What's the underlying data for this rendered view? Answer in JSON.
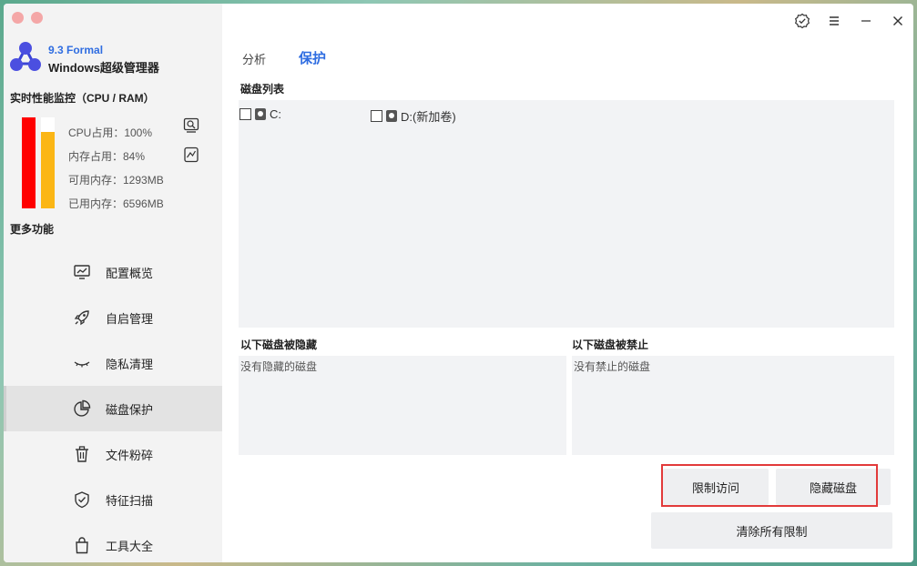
{
  "app": {
    "version": "9.3 Formal",
    "name": "Windows超级管理器"
  },
  "monitor": {
    "title": "实时性能监控（CPU / RAM）",
    "cpu_percent": 100,
    "ram_percent": 84,
    "cpu_label": "CPU占用：100%",
    "ram_label": "内存占用：84%",
    "avail_label": "可用内存：1293MB",
    "used_label": "已用内存：6596MB",
    "cpu_color": "#ff0000",
    "ram_color": "#fbb615"
  },
  "more_features": "更多功能",
  "nav": [
    {
      "label": "配置概览",
      "icon": "chart-monitor-icon",
      "active": false
    },
    {
      "label": "自启管理",
      "icon": "rocket-icon",
      "active": false
    },
    {
      "label": "隐私清理",
      "icon": "closed-eye-icon",
      "active": false
    },
    {
      "label": "磁盘保护",
      "icon": "pie-chart-icon",
      "active": true
    },
    {
      "label": "文件粉碎",
      "icon": "trash-icon",
      "active": false
    },
    {
      "label": "特征扫描",
      "icon": "shield-check-icon",
      "active": false
    },
    {
      "label": "工具大全",
      "icon": "bag-icon",
      "active": false
    }
  ],
  "tabs": [
    {
      "label": "分析",
      "active": false
    },
    {
      "label": "保护",
      "active": true
    }
  ],
  "disk_list": {
    "label": "磁盘列表",
    "items": [
      "C:",
      "D:(新加卷)"
    ]
  },
  "hidden_panel": {
    "label": "以下磁盘被隐藏",
    "empty_text": "没有隐藏的磁盘"
  },
  "banned_panel": {
    "label": "以下磁盘被禁止",
    "empty_text": "没有禁止的磁盘"
  },
  "buttons": {
    "restrict": "限制访问",
    "hide": "隐藏磁盘",
    "clear": "清除所有限制"
  },
  "colors": {
    "accent": "#2f6de1",
    "highlight": "#e23a3a"
  }
}
